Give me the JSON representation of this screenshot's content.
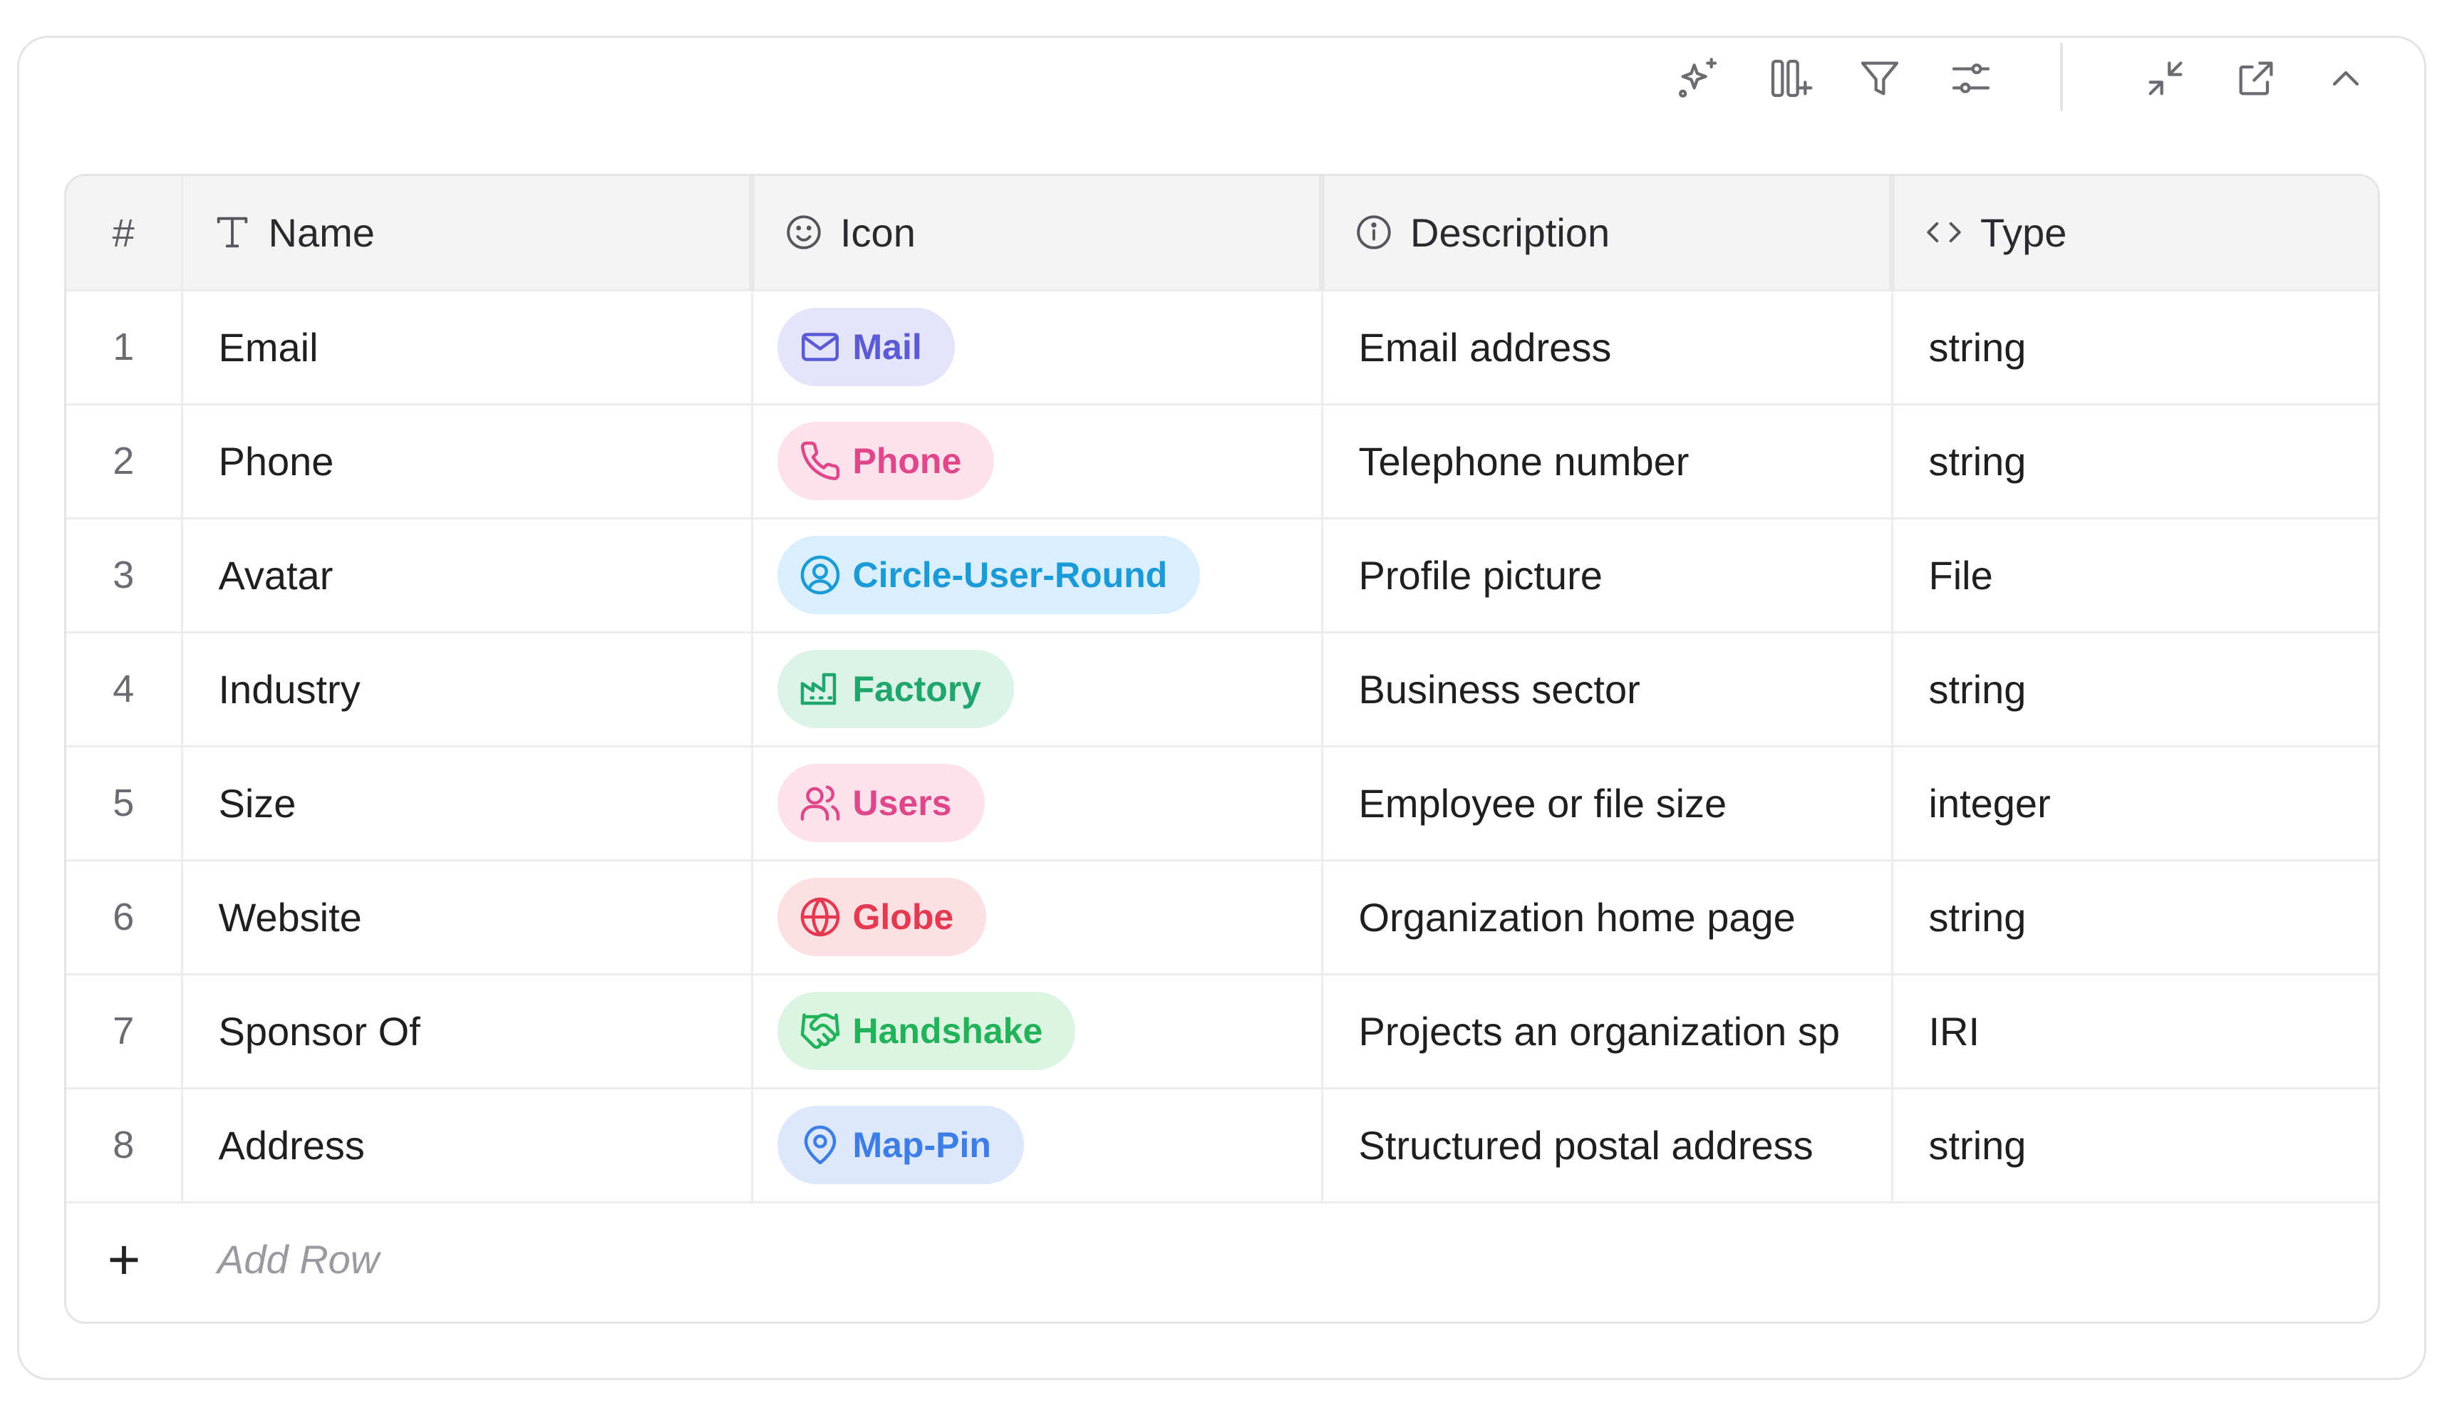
{
  "toolbar": {
    "icons": [
      "sparkles-icon",
      "add-column-icon",
      "filter-icon",
      "settings-sliders-icon",
      "collapse-icon",
      "open-external-icon",
      "chevron-up-icon"
    ]
  },
  "table": {
    "columns": {
      "num": "#",
      "name": "Name",
      "icon": "Icon",
      "description": "Description",
      "type": "Type"
    },
    "rows": [
      {
        "num": "1",
        "name": "Email",
        "icon_label": "Mail",
        "icon": "mail-icon",
        "chip_bg": "#e4e4fb",
        "chip_fg": "#5b5bd6",
        "description": "Email address",
        "type": "string"
      },
      {
        "num": "2",
        "name": "Phone",
        "icon_label": "Phone",
        "icon": "phone-icon",
        "chip_bg": "#fde2ec",
        "chip_fg": "#e0468a",
        "description": "Telephone number",
        "type": "string"
      },
      {
        "num": "3",
        "name": "Avatar",
        "icon_label": "Circle-User-Round",
        "icon": "circle-user-round-icon",
        "chip_bg": "#d9efff",
        "chip_fg": "#1a9ad6",
        "description": "Profile picture",
        "type": "File"
      },
      {
        "num": "4",
        "name": "Industry",
        "icon_label": "Factory",
        "icon": "factory-icon",
        "chip_bg": "#dcf3e8",
        "chip_fg": "#1fa66c",
        "description": "Business sector",
        "type": "string"
      },
      {
        "num": "5",
        "name": "Size",
        "icon_label": "Users",
        "icon": "users-icon",
        "chip_bg": "#fde2ec",
        "chip_fg": "#e0468a",
        "description": "Employee or file size",
        "type": "integer"
      },
      {
        "num": "6",
        "name": "Website",
        "icon_label": "Globe",
        "icon": "globe-icon",
        "chip_bg": "#fde0e3",
        "chip_fg": "#e53950",
        "description": "Organization home page",
        "type": "string"
      },
      {
        "num": "7",
        "name": "Sponsor Of",
        "icon_label": "Handshake",
        "icon": "handshake-icon",
        "chip_bg": "#dcf5e2",
        "chip_fg": "#22b35a",
        "description": "Projects an organization sp",
        "type": "IRI"
      },
      {
        "num": "8",
        "name": "Address",
        "icon_label": "Map-Pin",
        "icon": "map-pin-icon",
        "chip_bg": "#dde8fd",
        "chip_fg": "#3d7ee6",
        "description": "Structured postal address",
        "type": "string"
      }
    ],
    "add_row": {
      "symbol": "+",
      "label": "Add Row"
    }
  }
}
